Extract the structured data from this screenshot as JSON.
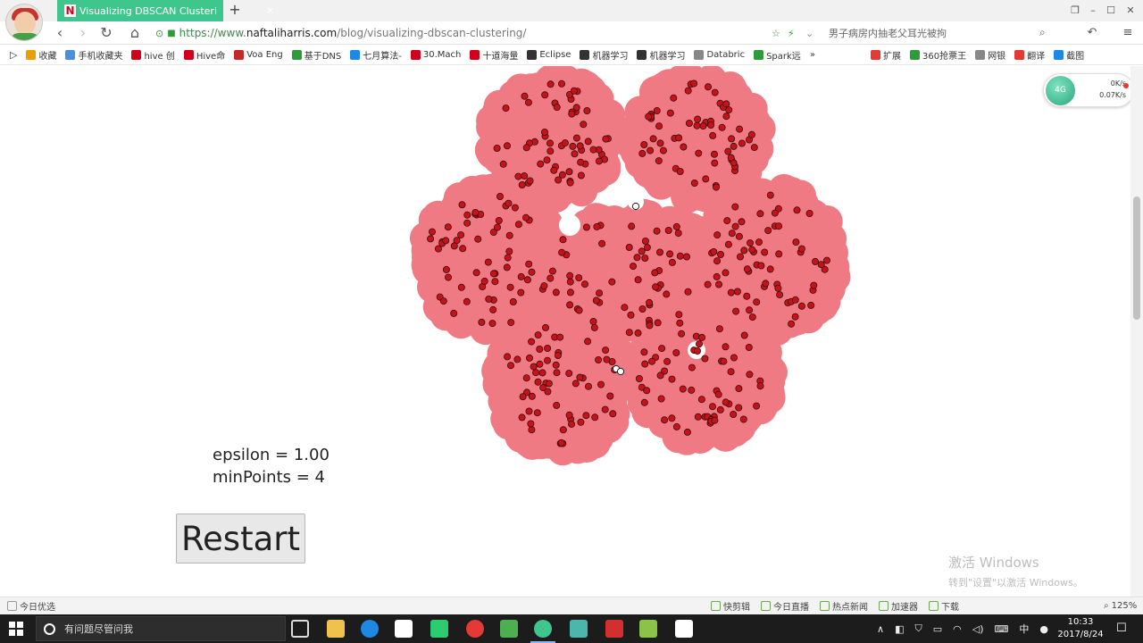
{
  "tab": {
    "logo": "N",
    "title": "Visualizing DBSCAN Clusteri",
    "close": "×",
    "new_tab": "+"
  },
  "window": {
    "restore": "❐",
    "minimize": "–",
    "maximize": "☐",
    "close": "✕"
  },
  "nav": {
    "back": "‹",
    "forward": "›",
    "reload": "↻",
    "home": "⌂"
  },
  "address": {
    "scheme": "https://www.",
    "host": "naftaliharris.com",
    "path": "/blog/visualizing-dbscan-clustering/"
  },
  "search": {
    "placeholder": "男子病房内抽老父耳光被拘"
  },
  "bookmarks": [
    {
      "label": "收藏",
      "color": "#e8a100"
    },
    {
      "label": "手机收藏夹",
      "color": "#4a90d9"
    },
    {
      "label": "hive 创",
      "color": "#d0021b"
    },
    {
      "label": "Hive命",
      "color": "#d0021b"
    },
    {
      "label": "Voa Eng",
      "color": "#c62828"
    },
    {
      "label": "基于DNS",
      "color": "#2e9b3a"
    },
    {
      "label": "七月算法-",
      "color": "#1e88e5"
    },
    {
      "label": "30.Mach",
      "color": "#d0021b"
    },
    {
      "label": "十道海量",
      "color": "#d0021b"
    },
    {
      "label": "Eclipse",
      "color": "#333333"
    },
    {
      "label": "机器学习",
      "color": "#333333"
    },
    {
      "label": "机器学习",
      "color": "#333333"
    },
    {
      "label": "Databric",
      "color": "#888888"
    },
    {
      "label": "Spark远",
      "color": "#2e9b3a"
    },
    {
      "label": "»",
      "color": ""
    }
  ],
  "bookmarks_right": [
    {
      "label": "扩展",
      "color": "#e53935"
    },
    {
      "label": "360抢票王",
      "color": "#2e9b3a"
    },
    {
      "label": "网银",
      "color": "#888888"
    },
    {
      "label": "翻译",
      "color": "#e53935"
    },
    {
      "label": "截图",
      "color": "#1e88e5"
    }
  ],
  "speed": {
    "up": "0K/s",
    "down": "0.07K/s",
    "ball": "4G"
  },
  "dbscan": {
    "epsilon_label": "epsilon = 1.00",
    "minpoints_label": "minPoints = 4",
    "restart_label": "Restart",
    "cluster_color": "#f07a84",
    "point_color": "#c5121b",
    "noise_color": "#ffffff"
  },
  "watermark": {
    "line1": "激活 Windows",
    "line2": "转到\"设置\"以激活 Windows。"
  },
  "statusbar": {
    "left": "今日优选",
    "items": [
      "快剪辑",
      "今日直播",
      "热点新闻",
      "加速器",
      "下载"
    ],
    "zoom": "125%"
  },
  "taskbar": {
    "search_placeholder": "有问题尽管问我",
    "time": "10:33",
    "date": "2017/8/24",
    "ime": "中"
  }
}
